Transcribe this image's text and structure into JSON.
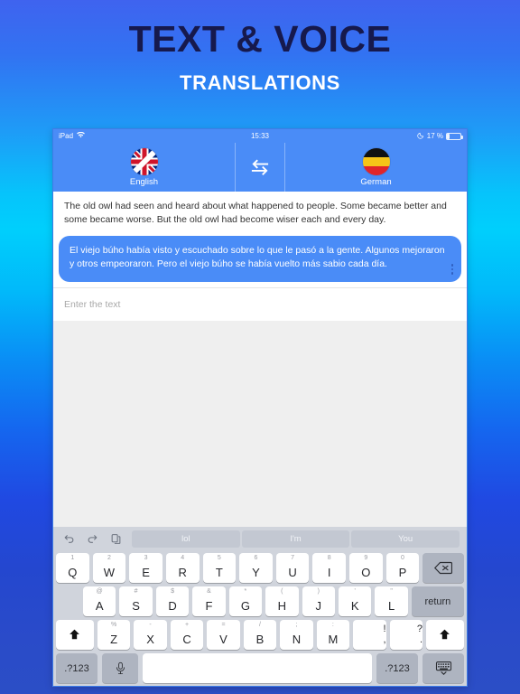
{
  "promo": {
    "title": "TEXT & VOICE",
    "subtitle": "TRANSLATIONS"
  },
  "colors": {
    "accent": "#4a8cf7",
    "headline": "#16194d",
    "keyboard_bg": "#d0d4dc",
    "key_bg": "#ffffff",
    "key_dark_bg": "#aeb4c0"
  },
  "statusbar": {
    "device": "iPad",
    "wifi_icon": "wifi-icon",
    "time": "15:33",
    "moon_icon": "moon-icon",
    "battery_percent": "17 %",
    "battery_icon": "battery-icon"
  },
  "langbar": {
    "source": {
      "label": "English",
      "flag": "flag-uk-icon"
    },
    "swap": {
      "icon": "swap-arrows-icon"
    },
    "target": {
      "label": "German",
      "flag": "flag-germany-icon"
    }
  },
  "conversation": {
    "source_text": "The old owl had seen and heard about what happened to people. Some became better and some became worse. But the old owl had become wiser each and every day.",
    "translated_text": "El viejo búho había visto y escuchado sobre lo que le pasó a la gente. Algunos mejoraron y otros empeoraron. Pero el viejo búho se había vuelto más sabio cada día.",
    "menu_icon": "kebab-menu-icon"
  },
  "input": {
    "placeholder": "Enter the text",
    "value": ""
  },
  "keyboard": {
    "suggestions": [
      "lol",
      "I'm",
      "You"
    ],
    "tool_icons": [
      "undo-icon",
      "redo-icon",
      "paste-icon"
    ],
    "row1": [
      {
        "alt": "1",
        "main": "Q"
      },
      {
        "alt": "2",
        "main": "W"
      },
      {
        "alt": "3",
        "main": "E"
      },
      {
        "alt": "4",
        "main": "R"
      },
      {
        "alt": "5",
        "main": "T"
      },
      {
        "alt": "6",
        "main": "Y"
      },
      {
        "alt": "7",
        "main": "U"
      },
      {
        "alt": "8",
        "main": "I"
      },
      {
        "alt": "9",
        "main": "O"
      },
      {
        "alt": "0",
        "main": "P"
      }
    ],
    "backspace_icon": "backspace-icon",
    "row2": [
      {
        "alt": "@",
        "main": "A"
      },
      {
        "alt": "#",
        "main": "S"
      },
      {
        "alt": "$",
        "main": "D"
      },
      {
        "alt": "&",
        "main": "F"
      },
      {
        "alt": "*",
        "main": "G"
      },
      {
        "alt": "(",
        "main": "H"
      },
      {
        "alt": ")",
        "main": "J"
      },
      {
        "alt": "'",
        "main": "K"
      },
      {
        "alt": "\"",
        "main": "L"
      }
    ],
    "return_label": "return",
    "row3": [
      {
        "alt": "%",
        "main": "Z"
      },
      {
        "alt": "-",
        "main": "X"
      },
      {
        "alt": "+",
        "main": "C"
      },
      {
        "alt": "=",
        "main": "V"
      },
      {
        "alt": "/",
        "main": "B"
      },
      {
        "alt": ";",
        "main": "N"
      },
      {
        "alt": ":",
        "main": "M"
      }
    ],
    "row3_punct": [
      {
        "top": "!",
        "bot": ","
      },
      {
        "top": "?",
        "bot": "."
      }
    ],
    "shift_icon": "shift-icon",
    "bottom": {
      "numeric_left": ".?123",
      "mic_icon": "microphone-icon",
      "space": "",
      "numeric_right": ".?123",
      "dismiss_icon": "hide-keyboard-icon"
    }
  }
}
